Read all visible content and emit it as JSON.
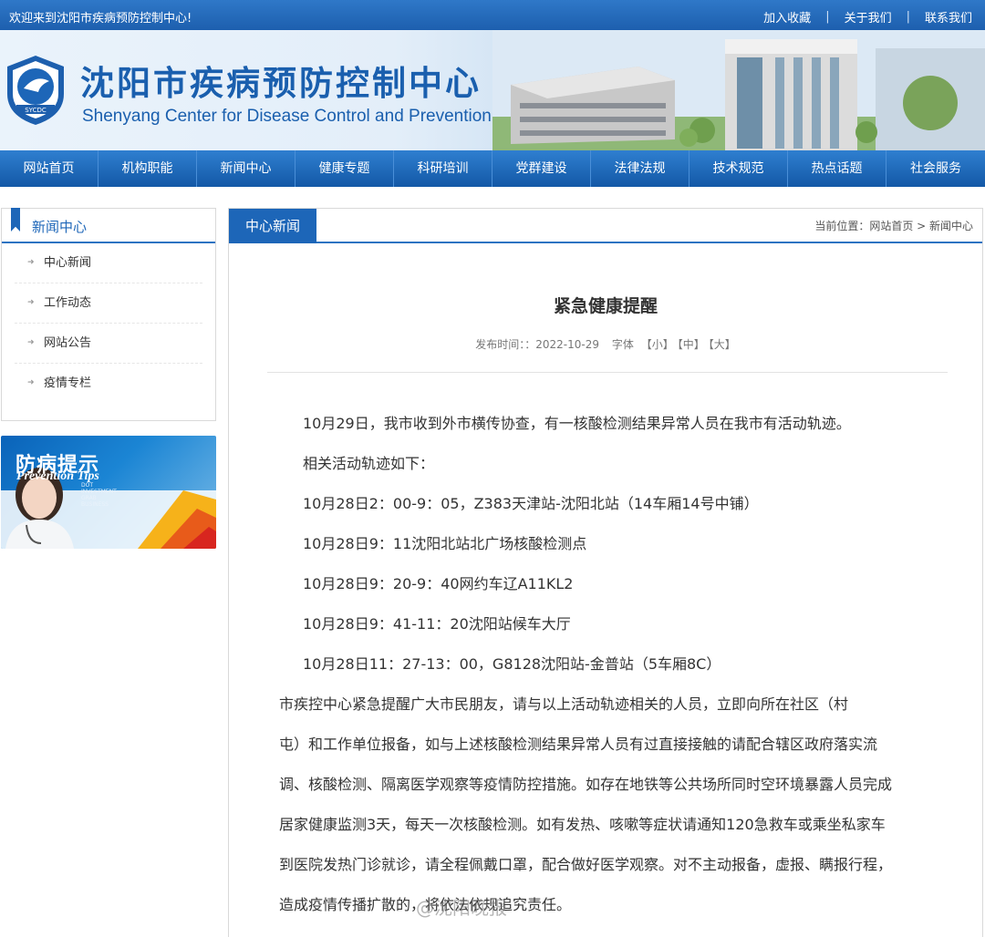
{
  "topbar": {
    "welcome": "欢迎来到沈阳市疾病预防控制中心!",
    "links": [
      "加入收藏",
      "关于我们",
      "联系我们"
    ]
  },
  "header": {
    "logo_text": "SYCDC",
    "title_cn": "沈阳市疾病预防控制中心",
    "title_en": "Shenyang Center for Disease Control and Prevention"
  },
  "nav": {
    "items": [
      "网站首页",
      "机构职能",
      "新闻中心",
      "健康专题",
      "科研培训",
      "党群建设",
      "法律法规",
      "技术规范",
      "热点话题",
      "社会服务"
    ]
  },
  "sidebar": {
    "title": "新闻中心",
    "items": [
      "中心新闻",
      "工作动态",
      "网站公告",
      "疫情专栏"
    ]
  },
  "tips_banner": {
    "title_cn": "防病提示",
    "title_en": "Prevention Tips",
    "small_text": "DOT INVESTMENT GRAB BUSINESS"
  },
  "main": {
    "tab": "中心新闻",
    "breadcrumb": "当前位置：网站首页 > 新闻中心",
    "article_title": "紧急健康提醒",
    "meta": {
      "publish_label": "发布时间：：2022-10-29",
      "font_label": "字体",
      "small": "【小】",
      "medium": "【中】",
      "large": "【大】"
    },
    "paragraphs": [
      "10月29日，我市收到外市横传协查，有一核酸检测结果异常人员在我市有活动轨迹。",
      "相关活动轨迹如下：",
      "10月28日2：00-9：05，Z383天津站-沈阳北站（14车厢14号中铺）",
      "10月28日9：11沈阳北站北广场核酸检测点",
      "10月28日9：20-9：40网约车辽A11KL2",
      "10月28日9：41-11：20沈阳站候车大厅",
      "10月28日11：27-13：00，G8128沈阳站-金普站（5车厢8C）"
    ],
    "body_lines": [
      "市疾控中心紧急提醒广大市民朋友，请与以上活动轨迹相关的人员，立即向所在社区（村",
      "屯）和工作单位报备，如与上述核酸检测结果异常人员有过直接接触的请配合辖区政府落实流",
      "调、核酸检测、隔离医学观察等疫情防控措施。如存在地铁等公共场所同时空环境暴露人员完成",
      "居家健康监测3天，每天一次核酸检测。如有发热、咳嗽等症状请通知120急救车或乘坐私家车",
      "到医院发热门诊就诊，请全程佩戴口罩，配合做好医学观察。对不主动报备，虚报、瞒报行程，",
      "造成疫情传播扩散的，将依法依规追究责任。"
    ]
  },
  "watermark": "@沈阳晚报"
}
